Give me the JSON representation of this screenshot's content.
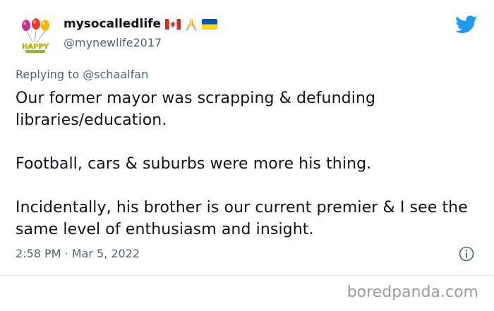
{
  "user": {
    "display_name": "mysocalledlife",
    "handle": "@mynewlife2017",
    "avatar_text": "HAPPY"
  },
  "replying": {
    "prefix": "Replying to",
    "mention": "@schaalfan"
  },
  "tweet": {
    "line1": "Our former mayor was scrapping & defunding libraries/education.",
    "line2": "Football, cars & suburbs were more his thing.",
    "line3": "Incidentally, his brother is our current premier & I see the same level of enthusiasm and insight."
  },
  "meta": {
    "timestamp": "2:58 PM · Mar 5, 2022"
  },
  "watermark": {
    "text": "boredpanda.com"
  },
  "colors": {
    "twitter_blue": "#1d9bf0",
    "secondary_text": "#536471",
    "primary_text": "#0f1419"
  },
  "icons": {
    "brand": "twitter-bird-icon",
    "info": "info-icon",
    "emoji": [
      "canada-flag-icon",
      "praying-hands-icon",
      "ukraine-flag-icon"
    ]
  }
}
